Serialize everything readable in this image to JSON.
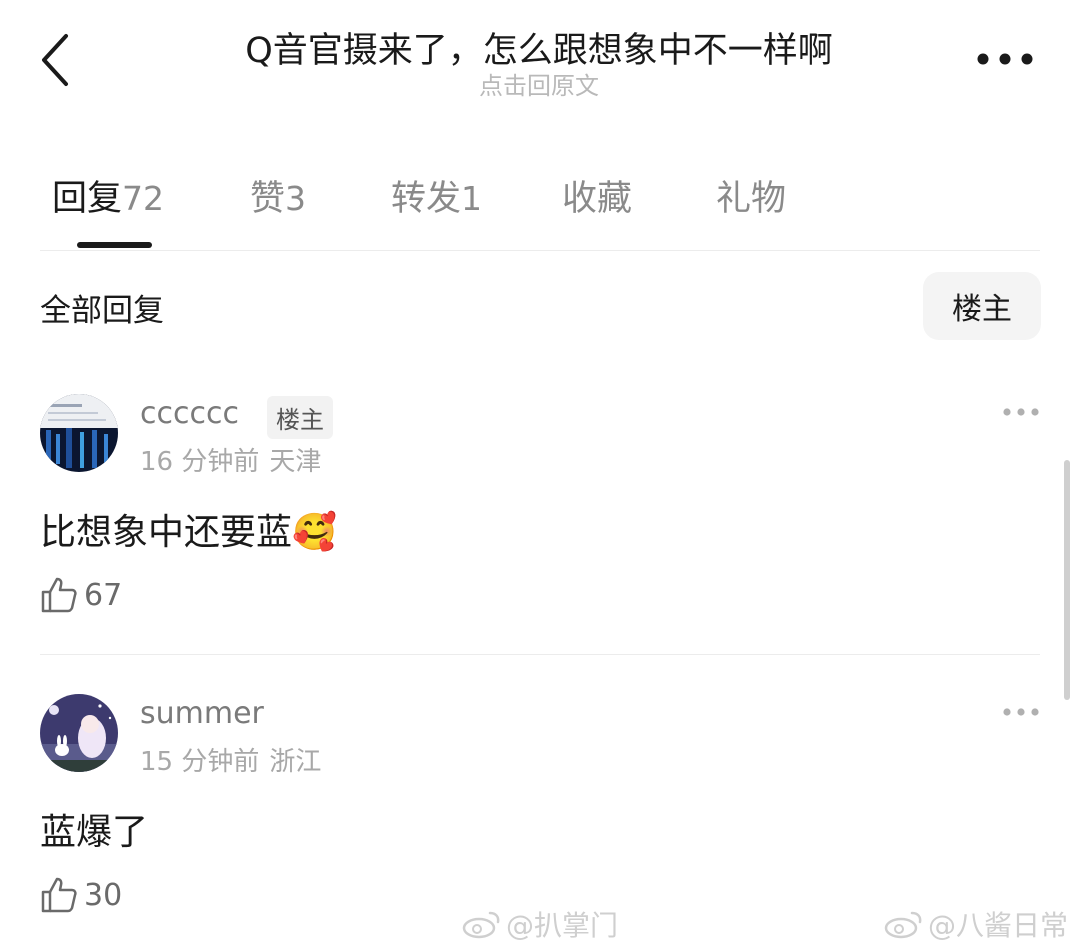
{
  "header": {
    "title": "Q音官摄来了，怎么跟想象中不一样啊",
    "subtitle": "点击回原文",
    "back_icon": "chevron-left-icon",
    "more_icon": "more-dots-icon"
  },
  "tabs": [
    {
      "label": "回复",
      "count": "72",
      "active": true
    },
    {
      "label": "赞",
      "count": "3",
      "active": false
    },
    {
      "label": "转发",
      "count": "1",
      "active": false
    },
    {
      "label": "收藏",
      "count": "",
      "active": false
    },
    {
      "label": "礼物",
      "count": "",
      "active": false
    }
  ],
  "filter": {
    "label": "全部回复",
    "op_button": "楼主"
  },
  "comments": [
    {
      "username": "cccccc",
      "badge": "楼主",
      "time": "16 分钟前",
      "location": "天津",
      "text": "比想象中还要蓝",
      "emoji": "🥰",
      "likes": "67"
    },
    {
      "username": "summer",
      "badge": "",
      "time": "15 分钟前",
      "location": "浙江",
      "text": "蓝爆了",
      "emoji": "",
      "likes": "30"
    }
  ],
  "watermarks": [
    "@扒掌门",
    "@八酱日常"
  ],
  "colors": {
    "text": "#1a1a1a",
    "muted": "#a8a8a8",
    "subtitle": "#b9b9b9",
    "chip_bg": "#f4f4f4"
  }
}
